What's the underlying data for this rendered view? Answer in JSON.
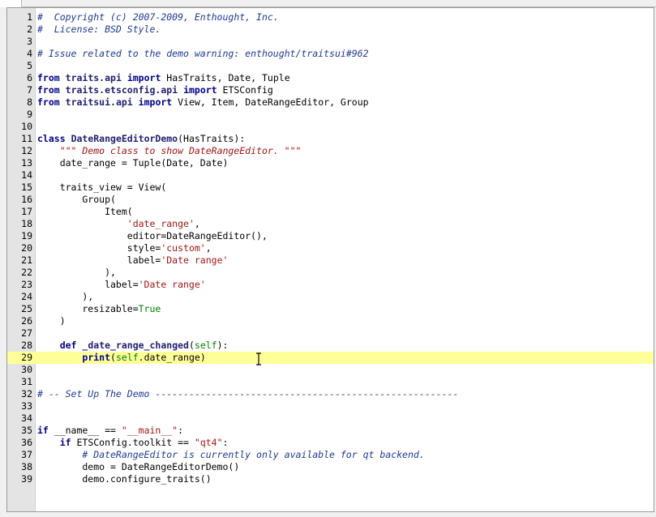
{
  "editor": {
    "lines": [
      {
        "num": "1",
        "html": "<span class=\"c\">#  Copyright (c) 2007-2009, Enthought, Inc.</span>"
      },
      {
        "num": "2",
        "html": "<span class=\"c\">#  License: BSD Style.</span>"
      },
      {
        "num": "3",
        "html": ""
      },
      {
        "num": "4",
        "html": "<span class=\"c\"># Issue related to the demo warning: enthought/traitsui#962</span>"
      },
      {
        "num": "5",
        "html": ""
      },
      {
        "num": "6",
        "html": "<span class=\"k\">from</span> <span class=\"n\">traits.api</span> <span class=\"k\">import</span> HasTraits, Date, Tuple"
      },
      {
        "num": "7",
        "html": "<span class=\"k\">from</span> <span class=\"n\">traits.etsconfig.api</span> <span class=\"k\">import</span> ETSConfig"
      },
      {
        "num": "8",
        "html": "<span class=\"k\">from</span> <span class=\"n\">traitsui.api</span> <span class=\"k\">import</span> View, Item, DateRangeEditor, Group"
      },
      {
        "num": "9",
        "html": ""
      },
      {
        "num": "10",
        "html": ""
      },
      {
        "num": "11",
        "html": "<span class=\"k\">class</span> <span class=\"n\">DateRangeEditorDemo</span>(HasTraits):"
      },
      {
        "num": "12",
        "html": "    <span class=\"s\"><i>\"\"\" Demo class to show DateRangeEditor. \"\"\"</i></span>"
      },
      {
        "num": "13",
        "html": "    date_range = Tuple(Date, Date)"
      },
      {
        "num": "14",
        "html": ""
      },
      {
        "num": "15",
        "html": "    traits_view = View("
      },
      {
        "num": "16",
        "html": "        Group("
      },
      {
        "num": "17",
        "html": "            Item("
      },
      {
        "num": "18",
        "html": "                <span class=\"s\">'date_range'</span>,"
      },
      {
        "num": "19",
        "html": "                editor=DateRangeEditor(),"
      },
      {
        "num": "20",
        "html": "                style=<span class=\"s\">'custom'</span>,"
      },
      {
        "num": "21",
        "html": "                label=<span class=\"s\">'Date range'</span>"
      },
      {
        "num": "22",
        "html": "            ),"
      },
      {
        "num": "23",
        "html": "            label=<span class=\"s\">'Date range'</span>"
      },
      {
        "num": "24",
        "html": "        ),"
      },
      {
        "num": "25",
        "html": "        resizable=<span class=\"f\">True</span>"
      },
      {
        "num": "26",
        "html": "    )"
      },
      {
        "num": "27",
        "html": ""
      },
      {
        "num": "28",
        "html": "    <span class=\"k\">def</span> <span class=\"n\">_date_range_changed</span>(<span class=\"f\">self</span>):"
      },
      {
        "num": "29",
        "html": "        <span class=\"k\">print</span>(<span class=\"f\">self</span>.date_range)",
        "current": true
      },
      {
        "num": "30",
        "html": ""
      },
      {
        "num": "31",
        "html": ""
      },
      {
        "num": "32",
        "html": "<span class=\"c\"># -- Set Up The Demo ------------------------------------------------------</span>"
      },
      {
        "num": "33",
        "html": ""
      },
      {
        "num": "34",
        "html": ""
      },
      {
        "num": "35",
        "html": "<span class=\"k\">if</span> __name__ == <span class=\"s\">\"__main__\"</span>:"
      },
      {
        "num": "36",
        "html": "    <span class=\"k\">if</span> ETSConfig.toolkit == <span class=\"s\">\"qt4\"</span>:"
      },
      {
        "num": "37",
        "html": "        <span class=\"c\"># DateRangeEditor is currently only available for qt backend.</span>"
      },
      {
        "num": "38",
        "html": "        demo = DateRangeEditorDemo()"
      },
      {
        "num": "39",
        "html": "        demo.configure_traits()"
      }
    ]
  },
  "icons": {
    "cursor": "text-cursor-icon"
  }
}
